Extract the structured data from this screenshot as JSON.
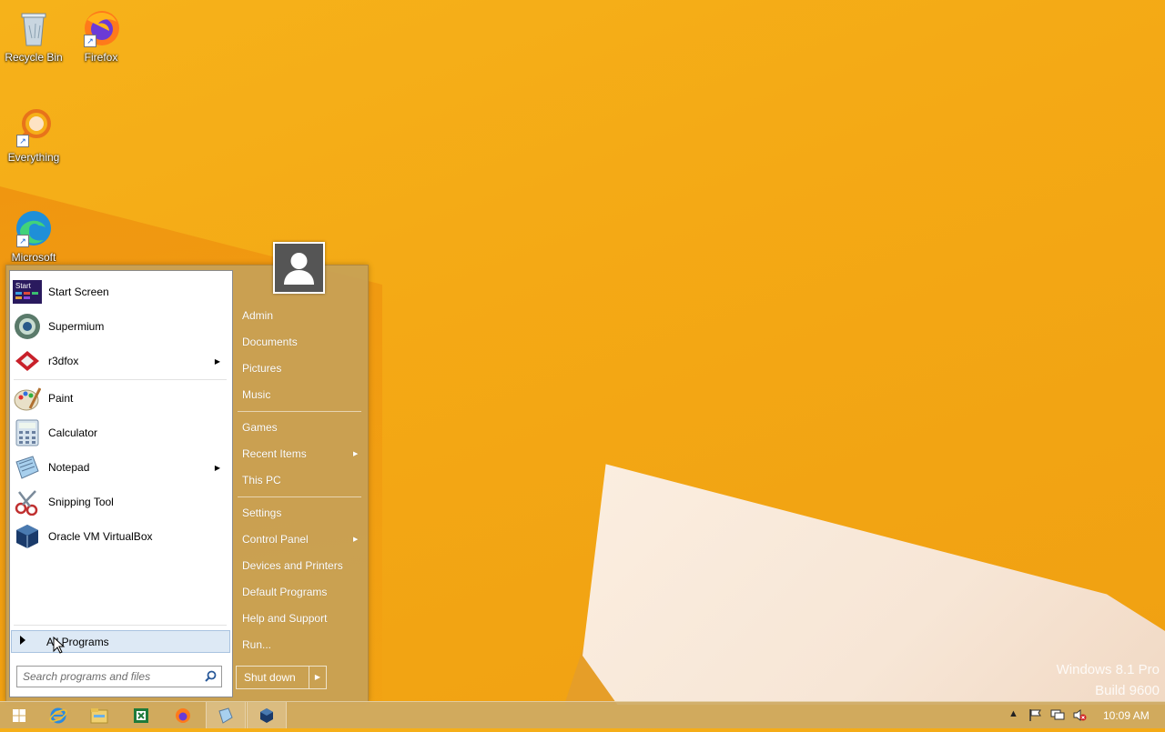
{
  "desktop": {
    "icons": [
      {
        "label": "Recycle Bin",
        "icon": "recycle-bin-icon"
      },
      {
        "label": "Firefox",
        "icon": "firefox-icon"
      },
      {
        "label": "Everything",
        "icon": "everything-icon"
      },
      {
        "label": "Microsoft",
        "icon": "edge-icon"
      }
    ],
    "watermark": {
      "line1": "Windows 8.1 Pro",
      "line2": "Build 9600"
    }
  },
  "start_menu": {
    "pinned": [
      {
        "label": "Start Screen",
        "icon": "start-screen-icon",
        "submenu": false
      },
      {
        "label": "Supermium",
        "icon": "supermium-icon",
        "submenu": false
      },
      {
        "label": "r3dfox",
        "icon": "r3dfox-icon",
        "submenu": true
      }
    ],
    "recent": [
      {
        "label": "Paint",
        "icon": "paint-icon",
        "submenu": false
      },
      {
        "label": "Calculator",
        "icon": "calculator-icon",
        "submenu": false
      },
      {
        "label": "Notepad",
        "icon": "notepad-icon",
        "submenu": true
      },
      {
        "label": "Snipping Tool",
        "icon": "snipping-tool-icon",
        "submenu": false
      },
      {
        "label": "Oracle VM VirtualBox",
        "icon": "virtualbox-icon",
        "submenu": false
      }
    ],
    "all_programs": "All Programs",
    "search_placeholder": "Search programs and files",
    "right": {
      "group1": [
        "Admin",
        "Documents",
        "Pictures",
        "Music"
      ],
      "group2": [
        "Games",
        "Recent Items",
        "This PC"
      ],
      "group3": [
        "Settings",
        "Control Panel",
        "Devices and Printers",
        "Default Programs",
        "Help and Support",
        "Run..."
      ]
    },
    "shutdown_label": "Shut down"
  },
  "taskbar": {
    "clock": "10:09 AM",
    "pinned": [
      "start-icon",
      "internet-explorer-icon",
      "file-explorer-icon",
      "excel-icon",
      "firefox-icon",
      "notepad-icon",
      "virtualbox-icon"
    ]
  }
}
